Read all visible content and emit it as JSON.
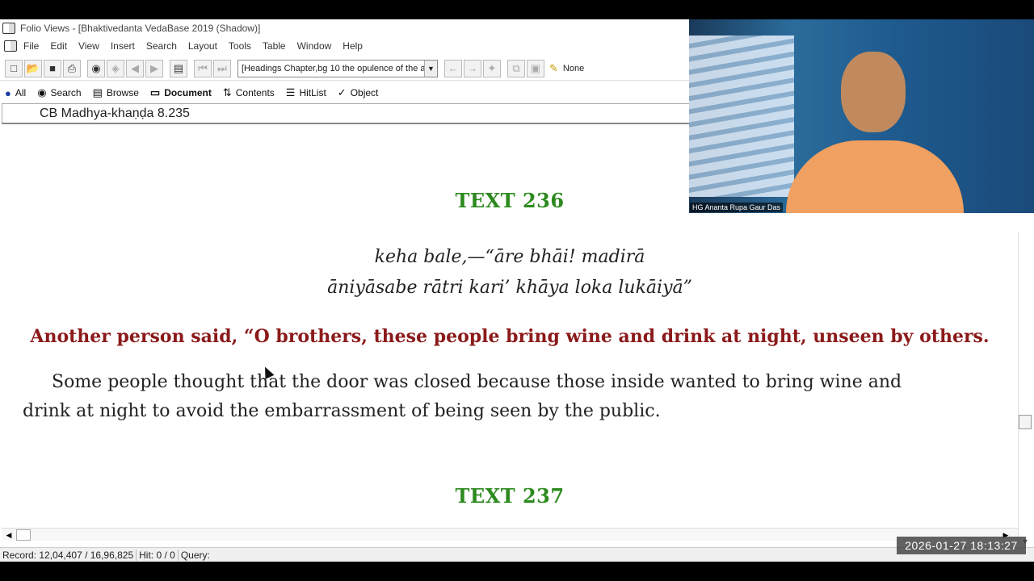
{
  "window": {
    "title": "Folio Views - [Bhaktivedanta VedaBase 2019 (Shadow)]"
  },
  "menu": [
    "File",
    "Edit",
    "View",
    "Insert",
    "Search",
    "Layout",
    "Tools",
    "Table",
    "Window",
    "Help"
  ],
  "toolbar": {
    "heading_select_value": "[Headings Chapter,bg 10 the opulence of the a",
    "highlighter_value": "None"
  },
  "view_tabs": [
    {
      "label": "All",
      "icon": "globe-icon"
    },
    {
      "label": "Search",
      "icon": "binoculars-icon"
    },
    {
      "label": "Browse",
      "icon": "book-icon"
    },
    {
      "label": "Document",
      "icon": "document-icon"
    },
    {
      "label": "Contents",
      "icon": "contents-icon"
    },
    {
      "label": "HitList",
      "icon": "list-icon"
    },
    {
      "label": "Object",
      "icon": "object-icon"
    }
  ],
  "location": "CB Madhya-khaṇḍa 8.235",
  "document": {
    "text236_heading": "TEXT 236",
    "verse_line1": "keha bale,—“āre bhāi! madirā",
    "verse_line2": "āniyāsabe rātri kari’ khāya loka lukāiyā”",
    "translation": "Another person said, “O brothers, these people bring wine and drink at night, unseen by others.",
    "purport": "Some people thought that the door was closed because those inside wanted to bring wine and drink at night to avoid the embarrassment of being seen by the public.",
    "text237_heading": "TEXT 237"
  },
  "statusbar": {
    "record": "Record: 12,04,407 / 16,96,825",
    "hit": "Hit: 0 / 0",
    "query": "Query:"
  },
  "webcam": {
    "name_label": "HG Ananta Rupa Gaur Das"
  },
  "timestamp": "2026-01-27  18:13:27",
  "colors": {
    "heading_green": "#2d8a1f",
    "translation_red": "#8b1a1a"
  }
}
